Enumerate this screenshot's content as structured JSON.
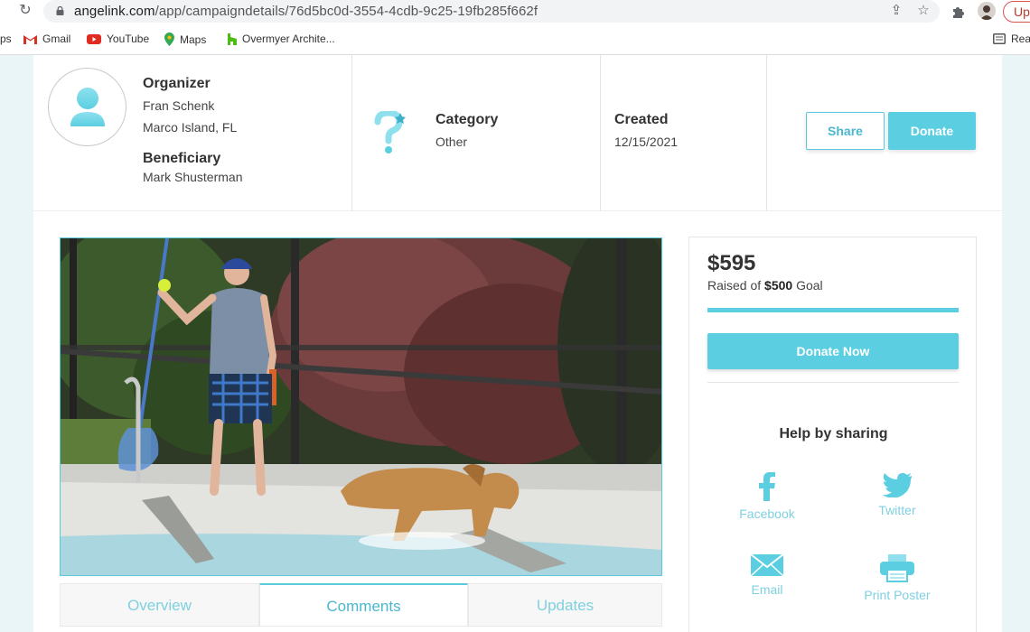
{
  "browser": {
    "url_host": "angelink.com",
    "url_path": "/app/campaigndetails/76d5bc0d-3554-4cdb-9c25-19fb285f662f",
    "update_label": "Up",
    "bookmarks": [
      {
        "label": "ps",
        "icon": "apps-icon"
      },
      {
        "label": "Gmail",
        "icon": "gmail-icon"
      },
      {
        "label": "YouTube",
        "icon": "youtube-icon"
      },
      {
        "label": "Maps",
        "icon": "maps-icon"
      },
      {
        "label": "Overmyer Archite...",
        "icon": "houzz-icon"
      }
    ],
    "reading_list_label": "Rea"
  },
  "campaign": {
    "organizer_label": "Organizer",
    "organizer_name": "Fran Schenk",
    "organizer_location": "Marco Island, FL",
    "beneficiary_label": "Beneficiary",
    "beneficiary_name": "Mark Shusterman",
    "category_label": "Category",
    "category_value": "Other",
    "created_label": "Created",
    "created_value": "12/15/2021",
    "share_label": "Share",
    "donate_label": "Donate"
  },
  "tabs": [
    {
      "label": "Overview",
      "active": false
    },
    {
      "label": "Comments",
      "active": true
    },
    {
      "label": "Updates",
      "active": false
    }
  ],
  "funding": {
    "raised": "$595",
    "raised_prefix": "Raised of",
    "goal": "$500",
    "goal_suffix": "Goal",
    "progress_fraction": 1.0,
    "donate_now_label": "Donate Now"
  },
  "sharing": {
    "title": "Help by sharing",
    "items": [
      {
        "label": "Facebook",
        "icon": "facebook-icon"
      },
      {
        "label": "Twitter",
        "icon": "twitter-icon"
      },
      {
        "label": "Email",
        "icon": "email-icon"
      },
      {
        "label": "Print Poster",
        "icon": "printer-icon"
      }
    ]
  },
  "colors": {
    "accent": "#5bcfe1",
    "accent_text": "#7fd0e0"
  }
}
